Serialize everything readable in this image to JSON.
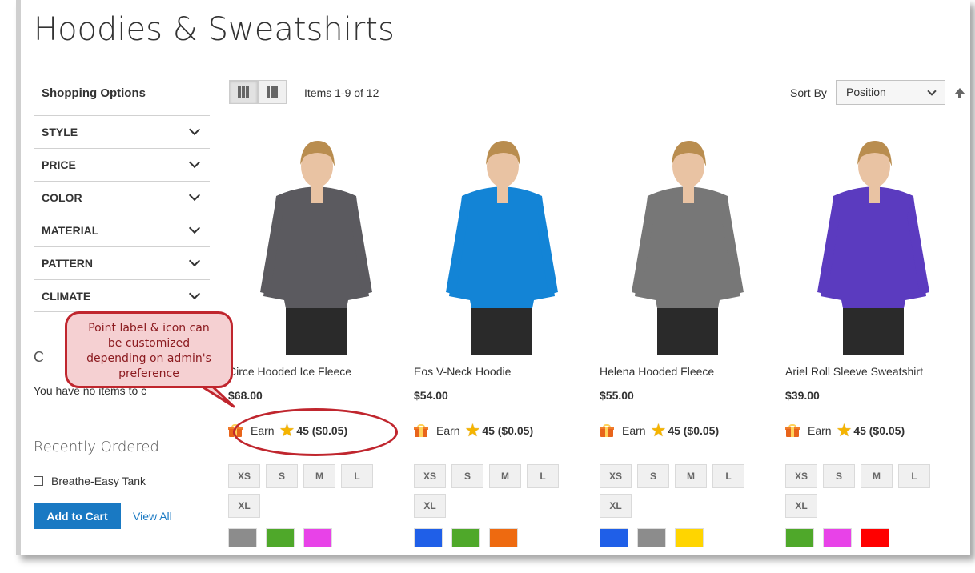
{
  "page": {
    "title": "Hoodies & Sweatshirts"
  },
  "sidebar": {
    "shopping_options": "Shopping Options",
    "filters": [
      {
        "label": "STYLE"
      },
      {
        "label": "PRICE"
      },
      {
        "label": "COLOR"
      },
      {
        "label": "MATERIAL"
      },
      {
        "label": "PATTERN"
      },
      {
        "label": "CLIMATE"
      }
    ],
    "compare_title": "C",
    "compare_empty": "You have no items to c",
    "recently_ordered_title": "Recently Ordered",
    "recent_item": "Breathe-Easy Tank",
    "add_to_cart": "Add to Cart",
    "view_all": "View All"
  },
  "toolbar": {
    "items_count": "Items 1-9 of 12",
    "sort_label": "Sort By",
    "sort_value": "Position"
  },
  "callout": {
    "line1": "Point label & icon can",
    "line2": "be customized",
    "line3": "depending on admin's",
    "line4": "preference"
  },
  "products": [
    {
      "name": "Circe Hooded Ice Fleece",
      "price": "$68.00",
      "earn_label": "Earn",
      "points": "45 ($0.05)",
      "sizes": [
        "XS",
        "S",
        "M",
        "L",
        "XL"
      ],
      "swatches": [
        "#8c8c8c",
        "#4fa82a",
        "#e842e8"
      ],
      "garment": "#5b5a5f"
    },
    {
      "name": "Eos V-Neck Hoodie",
      "price": "$54.00",
      "earn_label": "Earn",
      "points": "45 ($0.05)",
      "sizes": [
        "XS",
        "S",
        "M",
        "L",
        "XL"
      ],
      "swatches": [
        "#1f5fe8",
        "#4fa82a",
        "#ee6a10"
      ],
      "garment": "#1384d6"
    },
    {
      "name": "Helena Hooded Fleece",
      "price": "$55.00",
      "earn_label": "Earn",
      "points": "45 ($0.05)",
      "sizes": [
        "XS",
        "S",
        "M",
        "L",
        "XL"
      ],
      "swatches": [
        "#1f5fe8",
        "#8c8c8c",
        "#ffd500"
      ],
      "garment": "#777777"
    },
    {
      "name": "Ariel Roll Sleeve Sweatshirt",
      "price": "$39.00",
      "earn_label": "Earn",
      "points": "45 ($0.05)",
      "sizes": [
        "XS",
        "S",
        "M",
        "L",
        "XL"
      ],
      "swatches": [
        "#4fa82a",
        "#e842e8",
        "#ff0000"
      ],
      "garment": "#5b3bbf"
    }
  ]
}
